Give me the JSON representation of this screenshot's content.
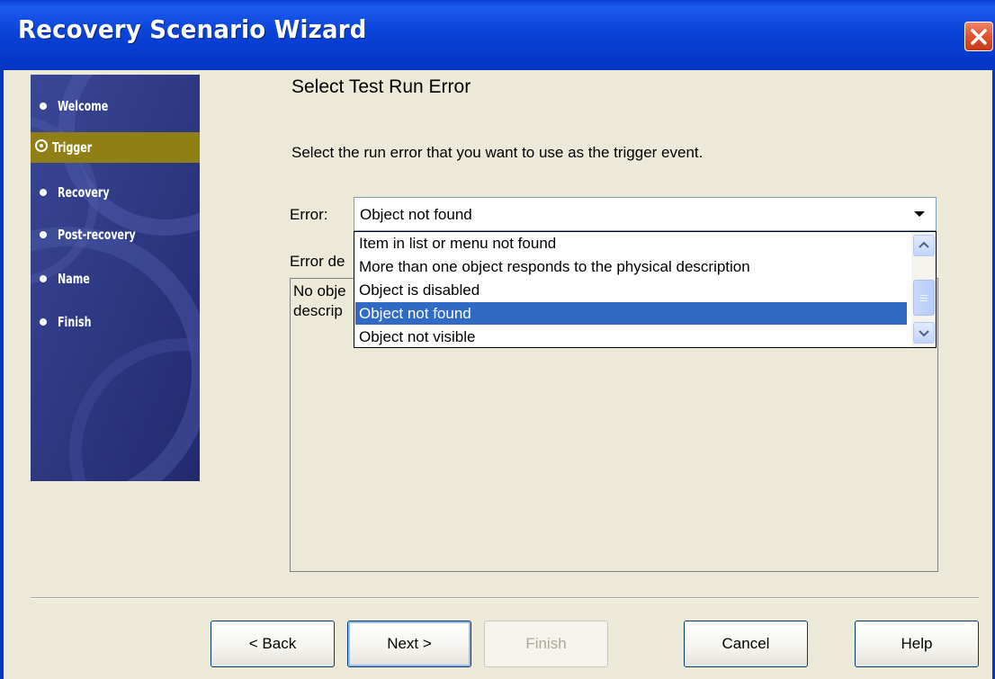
{
  "window": {
    "title": "Recovery Scenario Wizard",
    "close_icon": "close-icon"
  },
  "sidebar": {
    "steps": [
      {
        "label": "Welcome",
        "active": false
      },
      {
        "label": "Trigger",
        "active": true
      },
      {
        "label": "Recovery",
        "active": false
      },
      {
        "label": "Post-recovery",
        "active": false
      },
      {
        "label": "Name",
        "active": false
      },
      {
        "label": "Finish",
        "active": false
      }
    ]
  },
  "main": {
    "heading": "Select Test Run Error",
    "instruction": "Select the run error that you want to use as the trigger event.",
    "error_label": "Error:",
    "error_value": "Object not found",
    "description_label": "Error de",
    "description_text_line1": "No obje",
    "description_text_line2": "descrip"
  },
  "dropdown": {
    "options": [
      "Item in list or menu not found",
      "More than one object responds to the physical description",
      "Object is disabled",
      "Object not found",
      "Object not visible"
    ],
    "selected_index": 3,
    "selection_color": "#316ac5"
  },
  "buttons": {
    "back": "< Back",
    "next": "Next >",
    "finish": "Finish",
    "cancel": "Cancel",
    "help": "Help"
  },
  "colors": {
    "titlebar": "#0a43d8",
    "sidebar": "#2e3a86",
    "active_step": "#8f7f14",
    "close_button": "#e0522f"
  }
}
